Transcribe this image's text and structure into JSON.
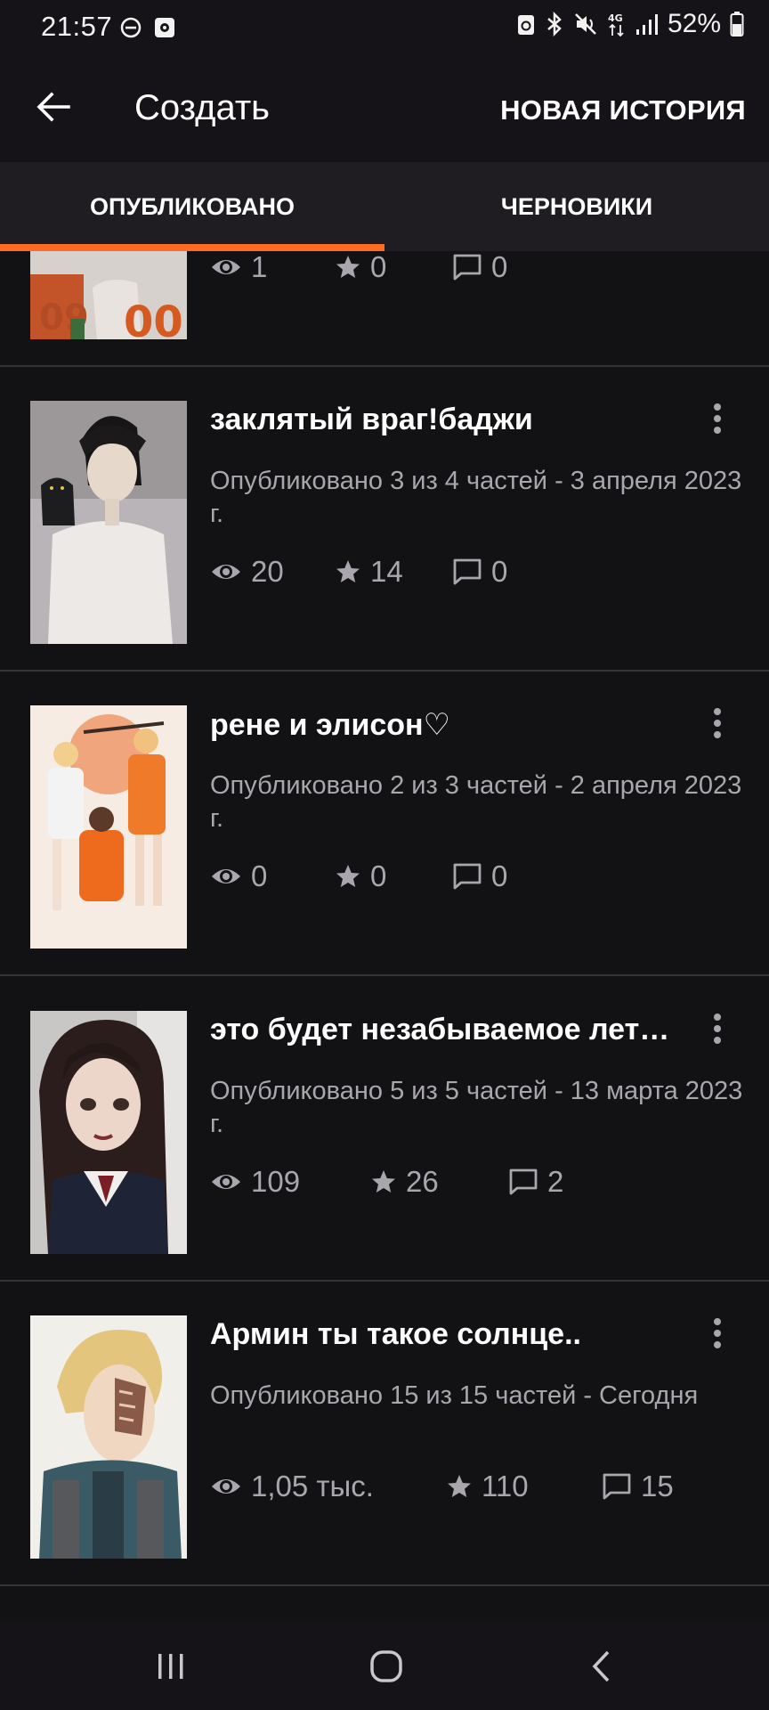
{
  "status_bar": {
    "time": "21:57",
    "battery": "52%",
    "icons": [
      "do-not-disturb-icon",
      "media-icon",
      "recycle-icon",
      "bluetooth-icon",
      "mute-icon",
      "4g-icon",
      "signal-icon",
      "battery-icon"
    ]
  },
  "header": {
    "title": "Создать",
    "new_story": "НОВАЯ ИСТОРИЯ"
  },
  "tabs": [
    {
      "label": "ОПУБЛИКОВАНО",
      "active": true
    },
    {
      "label": "ЧЕРНОВИКИ",
      "active": false
    }
  ],
  "colors": {
    "accent": "#ff6b22",
    "background": "#121114",
    "secondary_text": "#a9a6ad"
  },
  "stories": [
    {
      "title": "",
      "meta": "",
      "views": "1",
      "votes": "0",
      "comments": "0"
    },
    {
      "title": "заклятый враг!баджи",
      "meta": "Опубликовано 3 из 4 частей - 3 апреля 2023 г.",
      "views": "20",
      "votes": "14",
      "comments": "0"
    },
    {
      "title": "рене и элисон♡",
      "meta": "Опубликовано 2 из 3 частей - 2 апреля 2023 г.",
      "views": "0",
      "votes": "0",
      "comments": "0"
    },
    {
      "title": "это будет незабываемое лет…",
      "meta": "Опубликовано 5 из 5 частей - 13 марта 2023 г.",
      "views": "109",
      "votes": "26",
      "comments": "2"
    },
    {
      "title": "Армин ты такое солнце..",
      "meta": "Опубликовано 15 из 15 частей - Сегодня",
      "views": "1,05 тыс.",
      "votes": "110",
      "comments": "15"
    }
  ],
  "nav": [
    "recents-icon",
    "home-icon",
    "back-icon"
  ]
}
